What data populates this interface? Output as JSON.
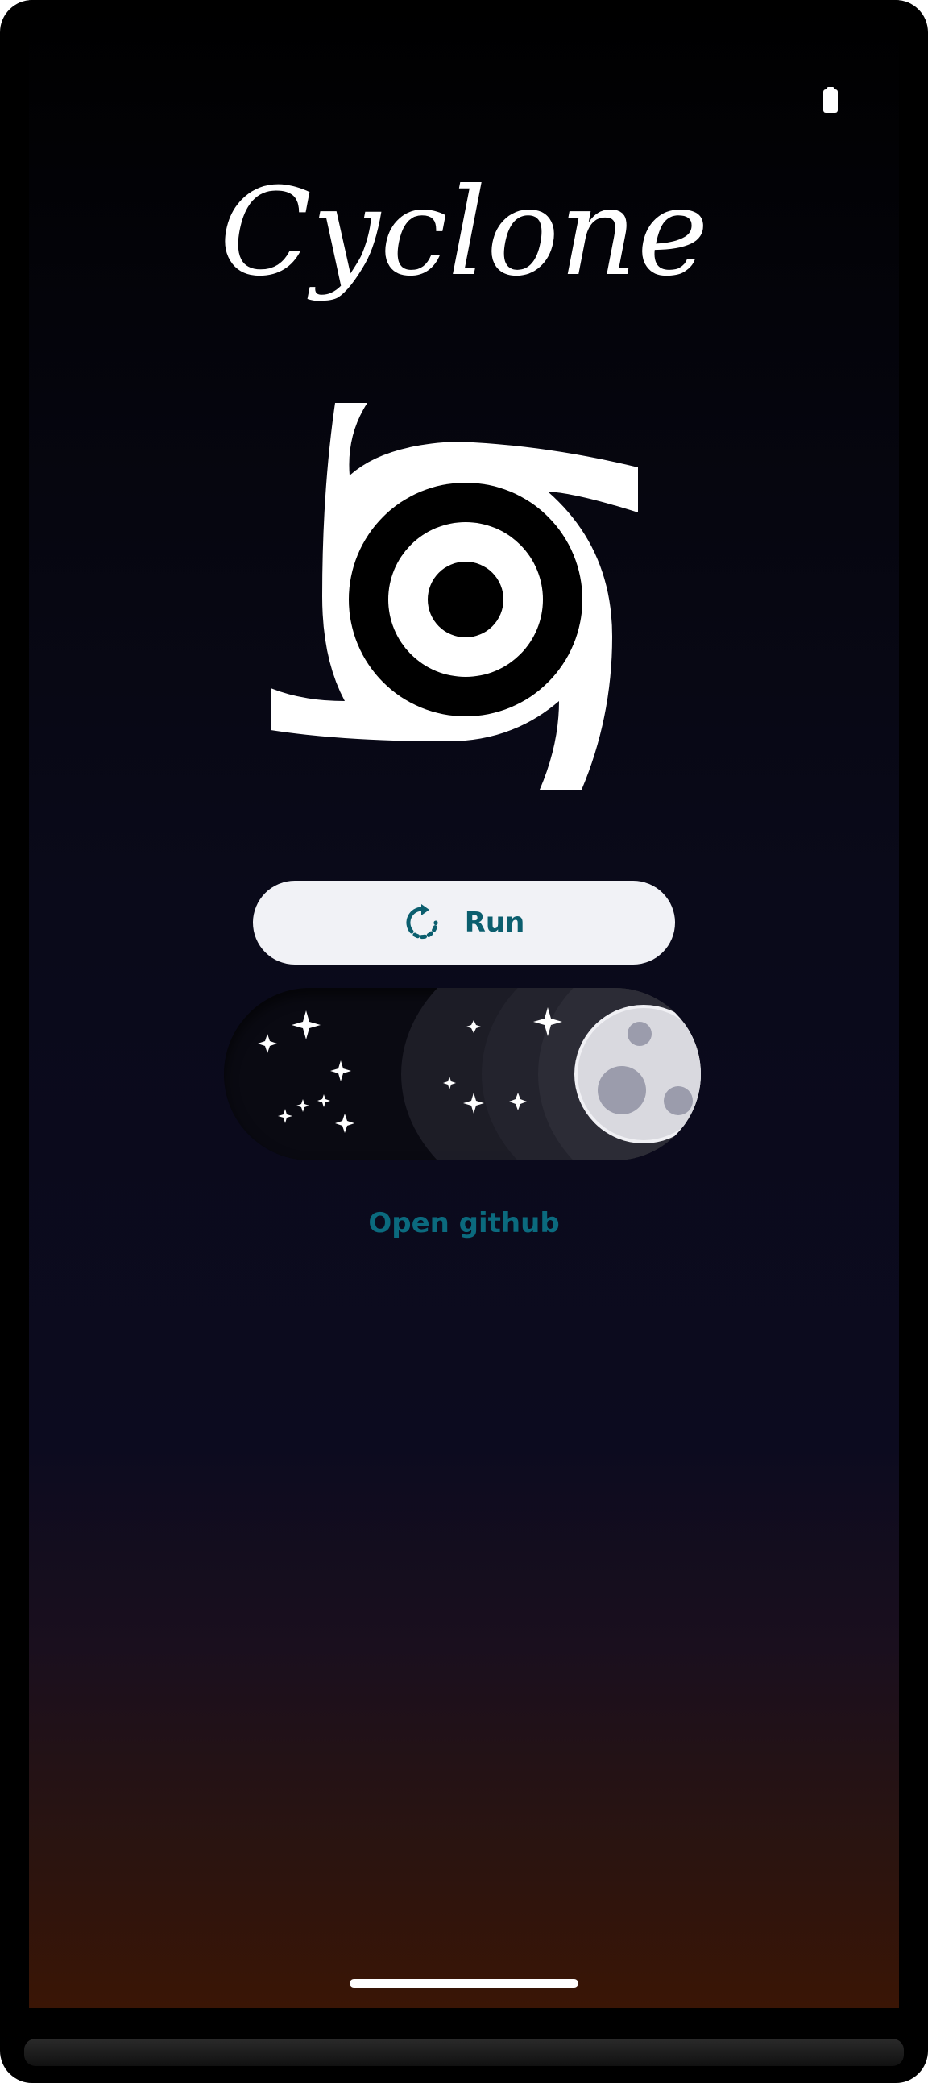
{
  "app": {
    "title": "Cyclone"
  },
  "status_bar": {
    "icons": [
      "battery-icon"
    ]
  },
  "logo": {
    "icon": "cyclone-logo-icon"
  },
  "actions": {
    "run_label": "Run",
    "run_icon": "refresh-icon",
    "theme_toggle_state": "dark",
    "theme_toggle_icon": "moon-icon",
    "open_github_label": "Open github"
  },
  "colors": {
    "accent": "#0b6a7e",
    "button_bg": "#f1f2f6",
    "text_light": "#ffffff"
  }
}
